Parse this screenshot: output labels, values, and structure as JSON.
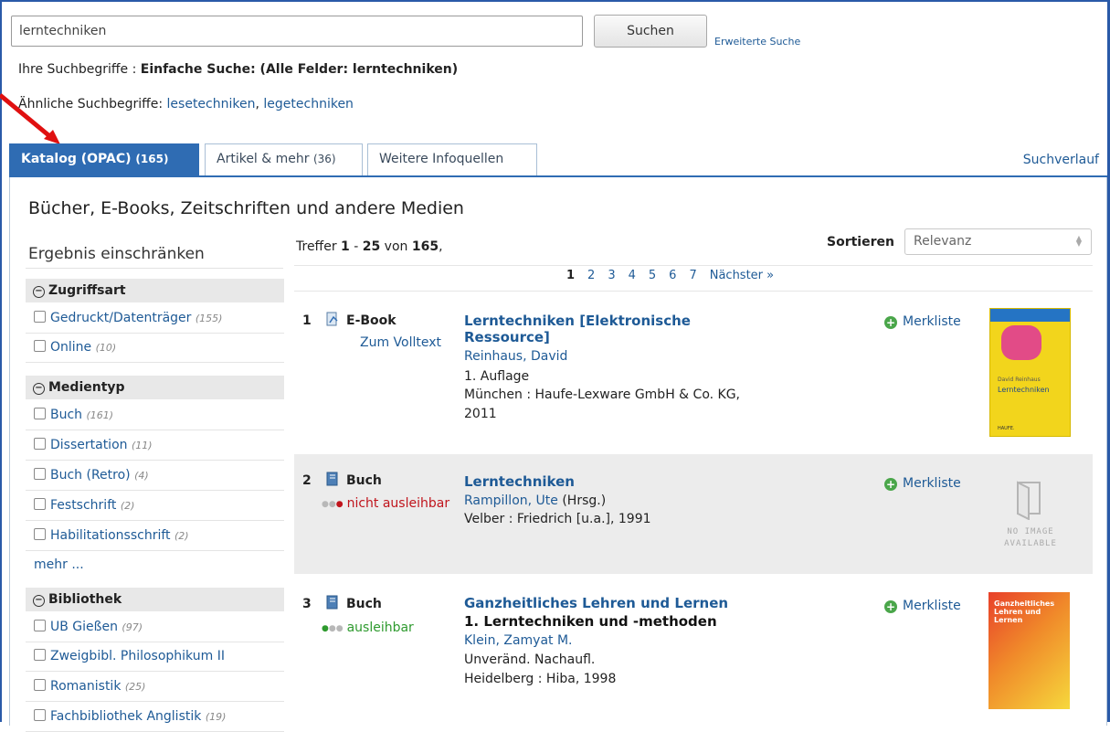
{
  "search": {
    "value": "lerntechniken",
    "button_label": "Suchen",
    "advanced_label": "Erweiterte Suche"
  },
  "terms": {
    "prefix": "Ihre Suchbegriffe : ",
    "value": "Einfache Suche: (Alle Felder: lerntechniken)"
  },
  "similar": {
    "prefix": "Ähnliche Suchbegriffe: ",
    "items": [
      "lesetechniken",
      "legetechniken"
    ],
    "separator": ", "
  },
  "tabs": [
    {
      "label": "Katalog (OPAC)",
      "count": "(165)",
      "active": true
    },
    {
      "label": "Artikel & mehr",
      "count": "(36)",
      "active": false
    },
    {
      "label": "Weitere Infoquellen",
      "count": "",
      "active": false
    }
  ],
  "history_label": "Suchverlauf",
  "section_heading": "Bücher, E-Books, Zeitschriften und andere Medien",
  "facets": {
    "title": "Ergebnis einschränken",
    "groups": [
      {
        "name": "Zugriffsart",
        "items": [
          {
            "label": "Gedruckt/Datenträger",
            "count": "(155)"
          },
          {
            "label": "Online",
            "count": "(10)"
          }
        ]
      },
      {
        "name": "Medientyp",
        "items": [
          {
            "label": "Buch",
            "count": "(161)"
          },
          {
            "label": "Dissertation",
            "count": "(11)"
          },
          {
            "label": "Buch (Retro)",
            "count": "(4)"
          },
          {
            "label": "Festschrift",
            "count": "(2)"
          },
          {
            "label": "Habilitationsschrift",
            "count": "(2)"
          }
        ]
      },
      {
        "name": "Bibliothek",
        "items": [
          {
            "label": "UB Gießen",
            "count": "(97)"
          },
          {
            "label": "Zweigbibl. Philosophikum II",
            "count": ""
          },
          {
            "label": "Romanistik",
            "count": "(25)"
          },
          {
            "label": "Fachbibliothek Anglistik",
            "count": "(19)"
          }
        ]
      }
    ],
    "more_label": "mehr ..."
  },
  "results_header": {
    "hits_prefix": "Treffer ",
    "from": "1",
    "dash": " - ",
    "to": "25",
    "of": " von ",
    "total": "165",
    "suffix": ",",
    "sort_label": "Sortieren",
    "sort_value": "Relevanz"
  },
  "pager": {
    "pages": [
      "1",
      "2",
      "3",
      "4",
      "5",
      "6",
      "7"
    ],
    "next_label": "Nächster »"
  },
  "results": [
    {
      "index": "1",
      "type": "E-Book",
      "sub_label": "Zum Volltext",
      "title": "Lerntechniken [Elektronische Ressource]",
      "author": "Reinhaus, David",
      "lines": [
        "1. Auflage",
        "München : Haufe-Lexware GmbH & Co. KG,",
        "2011"
      ],
      "merkliste": "Merkliste",
      "cover_text": "Lerntechniken",
      "cover_author": "David Reinhaus",
      "cover_publisher": "HAUFE."
    },
    {
      "index": "2",
      "type": "Buch",
      "status": "nicht ausleihbar",
      "status_color": "#c0141c",
      "title": "Lerntechniken",
      "author": "Rampillon, Ute",
      "author_suffix": " (Hrsg.)",
      "lines": [
        "Velber : Friedrich [u.a.], 1991"
      ],
      "merkliste": "Merkliste",
      "no_image_line1": "NO IMAGE",
      "no_image_line2": "AVAILABLE"
    },
    {
      "index": "3",
      "type": "Buch",
      "status": "ausleihbar",
      "status_color": "#2e9a2e",
      "title": "Ganzheitliches Lehren und Lernen",
      "subtitle": "1. Lerntechniken und -methoden",
      "author": "Klein, Zamyat M.",
      "lines": [
        "Unveränd. Nachaufl.",
        "Heidelberg : Hiba, 1998"
      ],
      "merkliste": "Merkliste",
      "cover_text": "Ganzheitliches Lehren und Lernen"
    }
  ],
  "colors": {
    "accent": "#2f6cb3",
    "link": "#1e5a96",
    "annotation_arrow": "#e01010"
  }
}
